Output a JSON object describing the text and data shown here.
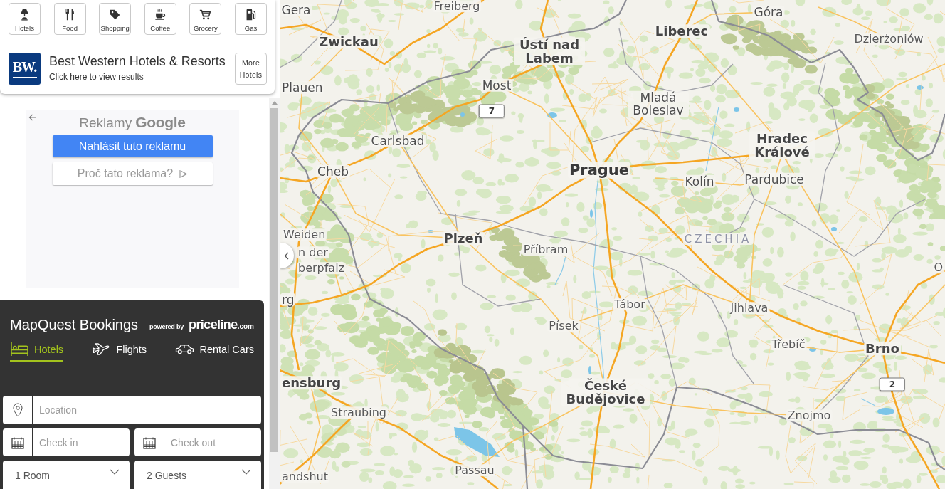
{
  "categories": [
    {
      "label": "Hotels"
    },
    {
      "label": "Food"
    },
    {
      "label": "Shopping"
    },
    {
      "label": "Coffee"
    },
    {
      "label": "Grocery"
    },
    {
      "label": "Gas"
    }
  ],
  "featured": {
    "logo": "BW.",
    "title": "Best Western Hotels & Resorts",
    "subtitle": "Click here to view results",
    "more_button": "More Hotels"
  },
  "ad": {
    "label": "Reklamy",
    "brand": "Google",
    "report_button": "Nahlásit tuto reklamu",
    "why_button": "Proč tato reklama?"
  },
  "bookings": {
    "title": "MapQuest Bookings",
    "powered_by": "powered by",
    "partner": {
      "name": "priceline",
      "suffix": ".com"
    },
    "tabs": [
      {
        "label": "Hotels",
        "selected": true
      },
      {
        "label": "Flights",
        "selected": false
      },
      {
        "label": "Rental Cars",
        "selected": false
      }
    ],
    "fields": [
      {
        "kind": "text",
        "placeholder": "Location"
      },
      {
        "kind": "date",
        "placeholder": "Check in"
      },
      {
        "kind": "date",
        "placeholder": "Check out"
      },
      {
        "kind": "select",
        "value": "1 Room"
      },
      {
        "kind": "select",
        "value": "2 Guests"
      }
    ]
  },
  "map": {
    "labels": [
      {
        "text": "Gera",
        "kind": "city"
      },
      {
        "text": "Freiberg",
        "kind": "town"
      },
      {
        "text": "Góra",
        "kind": "city"
      },
      {
        "text": "Zwickau",
        "kind": "major"
      },
      {
        "text": "Ústí nad Labem",
        "kind": "major"
      },
      {
        "text": "Liberec",
        "kind": "major"
      },
      {
        "text": "Dzierżoniów",
        "kind": "town"
      },
      {
        "text": "Plauen",
        "kind": "city"
      },
      {
        "text": "Most",
        "kind": "city"
      },
      {
        "text": "7",
        "kind": "road"
      },
      {
        "text": "Mladá Boleslav",
        "kind": "city"
      },
      {
        "text": "Carlsbad",
        "kind": "city"
      },
      {
        "text": "Hradec Králové",
        "kind": "major"
      },
      {
        "text": "Cheb",
        "kind": "city"
      },
      {
        "text": "Prague",
        "kind": "capital"
      },
      {
        "text": "Kolín",
        "kind": "city"
      },
      {
        "text": "Pardubice",
        "kind": "city"
      },
      {
        "text": "Weiden",
        "kind": "town"
      },
      {
        "text": "Plzeň",
        "kind": "major"
      },
      {
        "text": "CZECHIA",
        "kind": "country"
      },
      {
        "text": "n der",
        "kind": "town"
      },
      {
        "text": "Příbram",
        "kind": "town"
      },
      {
        "text": "berpfalz",
        "kind": "town"
      },
      {
        "text": "O",
        "kind": "town"
      },
      {
        "text": "rg",
        "kind": "city"
      },
      {
        "text": "Tábor",
        "kind": "town"
      },
      {
        "text": "Jihlava",
        "kind": "town"
      },
      {
        "text": "Písek",
        "kind": "town"
      },
      {
        "text": "Třebíč",
        "kind": "town"
      },
      {
        "text": "Brno",
        "kind": "major"
      },
      {
        "text": "ensburg",
        "kind": "major"
      },
      {
        "text": "České Budějovice",
        "kind": "major"
      },
      {
        "text": "2",
        "kind": "road"
      },
      {
        "text": "Straubing",
        "kind": "town"
      },
      {
        "text": "Znojmo",
        "kind": "town"
      },
      {
        "text": "andshut",
        "kind": "town"
      },
      {
        "text": "Passau",
        "kind": "town"
      }
    ]
  }
}
